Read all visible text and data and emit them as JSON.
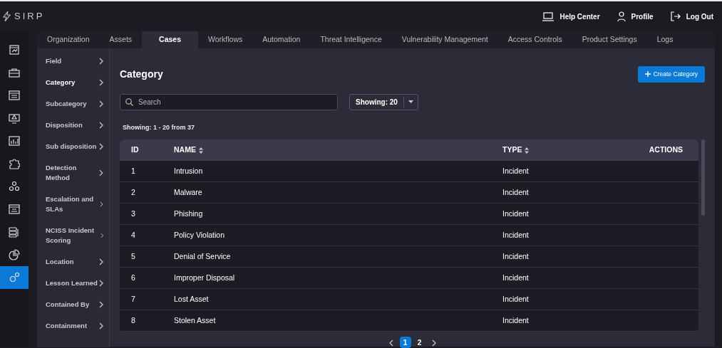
{
  "app": {
    "logo": "SIRP"
  },
  "header_links": [
    {
      "label": "Help Center"
    },
    {
      "label": "Profile"
    },
    {
      "label": "Log Out"
    }
  ],
  "rail": [
    {
      "selected": false
    },
    {
      "selected": false
    },
    {
      "selected": false
    },
    {
      "selected": false
    },
    {
      "selected": false
    },
    {
      "selected": false
    },
    {
      "selected": false
    },
    {
      "selected": false
    },
    {
      "selected": false
    },
    {
      "selected": false
    },
    {
      "selected": true
    }
  ],
  "tabs": [
    {
      "label": "Organization",
      "selected": false
    },
    {
      "label": "Assets",
      "selected": false
    },
    {
      "label": "Cases",
      "selected": true
    },
    {
      "label": "Workflows",
      "selected": false
    },
    {
      "label": "Automation",
      "selected": false
    },
    {
      "label": "Threat Intelligence",
      "selected": false
    },
    {
      "label": "Vulnerability Management",
      "selected": false
    },
    {
      "label": "Access Controls",
      "selected": false
    },
    {
      "label": "Product Settings",
      "selected": false
    },
    {
      "label": "Logs",
      "selected": false
    }
  ],
  "sidebar": {
    "items": [
      {
        "label": "Field",
        "selected": false
      },
      {
        "label": "Category",
        "selected": true
      },
      {
        "label": "Subcategory",
        "selected": false
      },
      {
        "label": "Disposition",
        "selected": false
      },
      {
        "label": "Sub disposition",
        "selected": false
      },
      {
        "label": "Detection Method",
        "selected": false
      },
      {
        "label": "Escalation and SLAs",
        "selected": false
      },
      {
        "label": "NCISS Incident Scoring",
        "selected": false
      },
      {
        "label": "Location",
        "selected": false
      },
      {
        "label": "Lesson Learned",
        "selected": false
      },
      {
        "label": "Contained By",
        "selected": false
      },
      {
        "label": "Containment",
        "selected": false
      }
    ]
  },
  "page": {
    "title": "Category",
    "create_button": "Create Category",
    "search": {
      "placeholder": "Search"
    },
    "page_size": "Showing: 20",
    "summary": "Showing: 1 - 20 from 37"
  },
  "table": {
    "columns": [
      {
        "label": "ID",
        "sortable": false
      },
      {
        "label": "NAME",
        "sortable": true
      },
      {
        "label": "TYPE",
        "sortable": true
      },
      {
        "label": "ACTIONS",
        "sortable": false
      }
    ],
    "rows": [
      [
        "1",
        "Intrusion",
        "Incident"
      ],
      [
        "2",
        "Malware",
        "Incident"
      ],
      [
        "3",
        "Phishing",
        "Incident"
      ],
      [
        "4",
        "Policy Violation",
        "Incident"
      ],
      [
        "5",
        "Denial of Service",
        "Incident"
      ],
      [
        "6",
        "Improper Disposal",
        "Incident"
      ],
      [
        "7",
        "Lost Asset",
        "Incident"
      ],
      [
        "8",
        "Stolen Asset",
        "Incident"
      ]
    ]
  },
  "pagination": {
    "pages": [
      {
        "label": "1",
        "selected": true
      },
      {
        "label": "2",
        "selected": false
      }
    ]
  }
}
